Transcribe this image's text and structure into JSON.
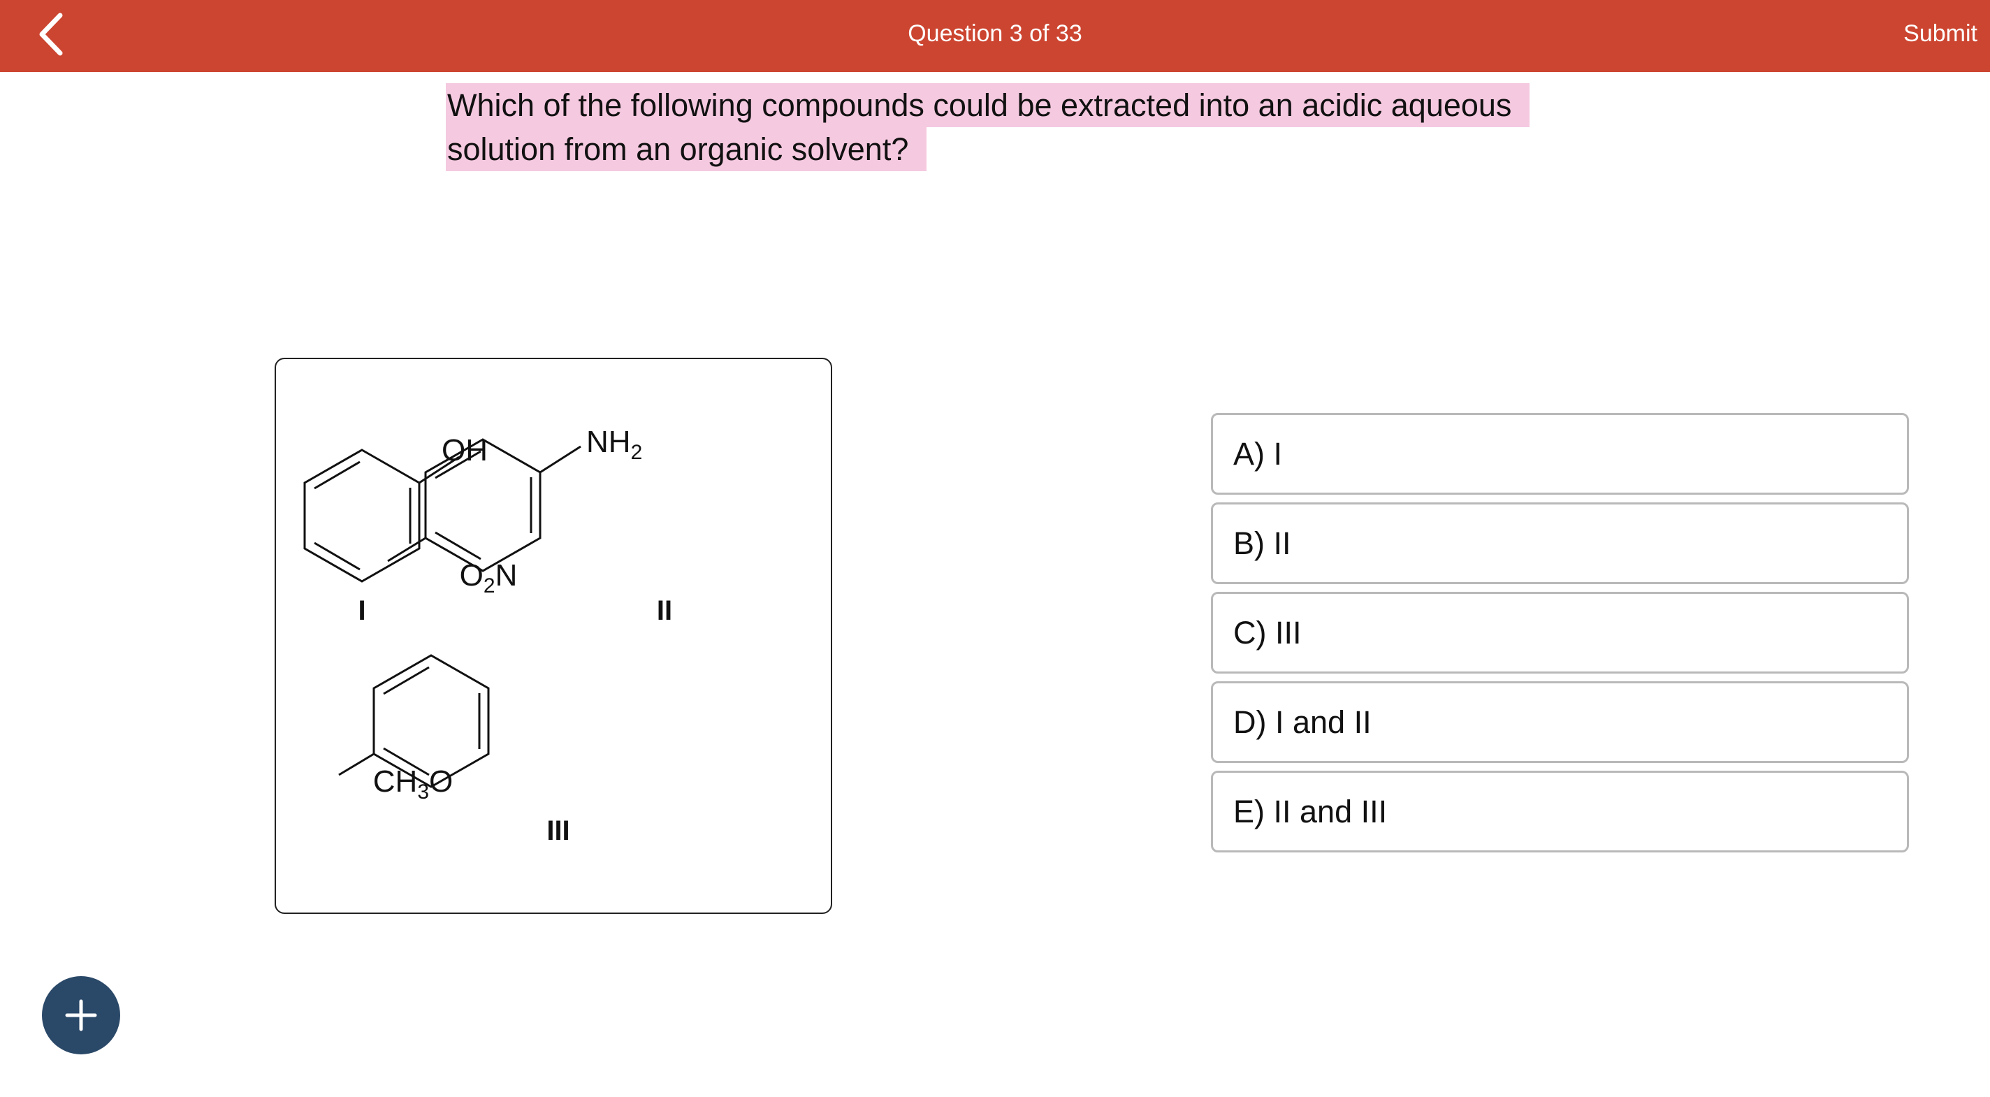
{
  "header": {
    "back_icon": "chevron-left-icon",
    "question_counter": "Question 3 of 33",
    "submit_label": "Submit",
    "bar_color": "#cc4530"
  },
  "question": {
    "text": "Which of the following compounds could be extracted into an acidic aqueous solution from an organic solvent?",
    "highlight_color": "#f5c9e0"
  },
  "figure": {
    "compounds": [
      {
        "label": "I",
        "substituents": [
          "OH"
        ]
      },
      {
        "label": "II",
        "substituents": [
          "NH",
          "2",
          "O",
          "2",
          "N"
        ]
      },
      {
        "label": "III",
        "substituents": [
          "CH",
          "3",
          "O"
        ]
      }
    ]
  },
  "options": [
    {
      "letter": "A",
      "text": "A) I"
    },
    {
      "letter": "B",
      "text": "B) II"
    },
    {
      "letter": "C",
      "text": "C) III"
    },
    {
      "letter": "D",
      "text": "D) I and II"
    },
    {
      "letter": "E",
      "text": "E) II and III"
    }
  ],
  "fab": {
    "icon": "plus-icon",
    "color": "#2a4868"
  }
}
